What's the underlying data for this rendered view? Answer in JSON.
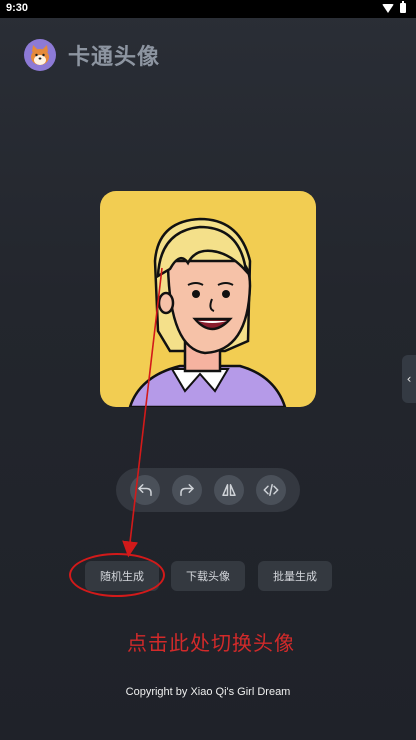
{
  "status_bar": {
    "time": "9:30",
    "icons": [
      "wifi-icon",
      "battery-icon"
    ]
  },
  "header": {
    "title": "卡通头像",
    "logo_icon": "shiba-dog-logo"
  },
  "side_handle": {
    "icon": "chevron-left-icon",
    "glyph": "‹"
  },
  "avatar": {
    "description_icon": "cartoon-avatar-image",
    "background_color": "#f2cd52"
  },
  "toolbar": {
    "buttons": [
      {
        "name": "undo",
        "icon": "undo-icon"
      },
      {
        "name": "redo",
        "icon": "redo-icon"
      },
      {
        "name": "flip",
        "icon": "flip-horizontal-icon"
      },
      {
        "name": "code",
        "icon": "code-icon"
      }
    ]
  },
  "actions": {
    "random": "随机生成",
    "download": "下载头像",
    "batch": "批量生成"
  },
  "annotation": {
    "text": "点击此处切换头像",
    "color": "#d22a2a"
  },
  "footer": {
    "copyright": "Copyright by Xiao Qi's Girl Dream"
  }
}
